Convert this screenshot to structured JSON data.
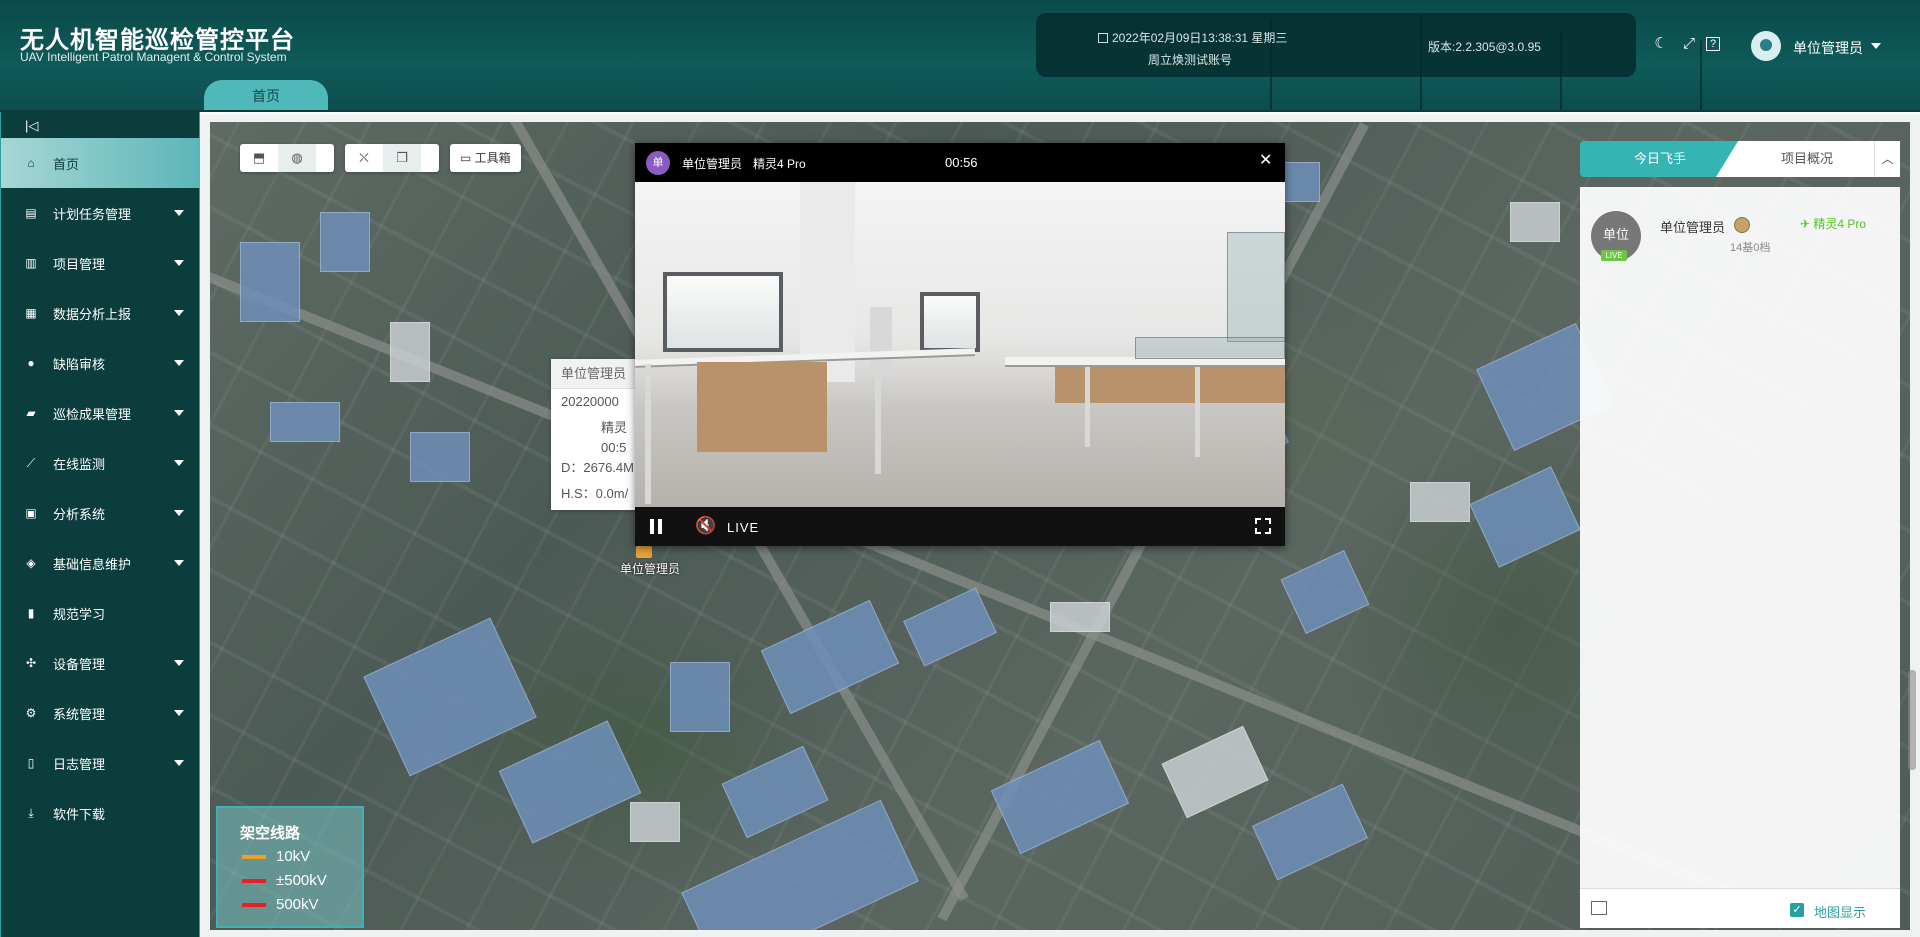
{
  "header": {
    "title_cn": "无人机智能巡检管控平台",
    "title_en": "UAV Intelligent Patrol Managent & Control System",
    "datetime": "2022年02月09日13:38:31 星期三",
    "account": "周立焕测试账号",
    "version": "版本:2.2.305@3.0.95",
    "user_name": "单位管理员",
    "home_tab": "首页"
  },
  "sidebar": {
    "collapse_icon": "collapse-left-icon",
    "items": [
      {
        "label": "首页",
        "icon": "home-icon",
        "active": true,
        "has_sub": false
      },
      {
        "label": "计划任务管理",
        "icon": "task-icon",
        "has_sub": true
      },
      {
        "label": "项目管理",
        "icon": "project-icon",
        "has_sub": true
      },
      {
        "label": "数据分析上报",
        "icon": "data-icon",
        "has_sub": true
      },
      {
        "label": "缺陷审核",
        "icon": "user-check-icon",
        "has_sub": true
      },
      {
        "label": "巡检成果管理",
        "icon": "folder-icon",
        "has_sub": true
      },
      {
        "label": "在线监测",
        "icon": "monitor-icon",
        "has_sub": true
      },
      {
        "label": "分析系统",
        "icon": "analysis-icon",
        "has_sub": true
      },
      {
        "label": "基础信息维护",
        "icon": "layers-icon",
        "has_sub": true
      },
      {
        "label": "规范学习",
        "icon": "book-icon",
        "has_sub": false
      },
      {
        "label": "设备管理",
        "icon": "drone-icon",
        "has_sub": true
      },
      {
        "label": "系统管理",
        "icon": "settings-user-icon",
        "has_sub": true
      },
      {
        "label": "日志管理",
        "icon": "log-icon",
        "has_sub": true
      },
      {
        "label": "软件下载",
        "icon": "download-icon",
        "has_sub": false
      }
    ]
  },
  "map": {
    "toolbox_label": "工具箱",
    "drone_card": {
      "title": "单位管理员",
      "serial": "20220000",
      "model": "精灵",
      "time": "00:5",
      "distance": "D：2676.4M",
      "hspeed": "H.S：0.0m/"
    },
    "drone_label": "单位管理员"
  },
  "video": {
    "avatar_text": "单",
    "user": "单位管理员",
    "model": "精灵4 Pro",
    "time": "00:56",
    "live_label": "LIVE"
  },
  "legend": {
    "title": "架空线路",
    "rows": [
      {
        "label": "10kV",
        "color": "#f0a020"
      },
      {
        "label": "±500kV",
        "color": "#e82020"
      },
      {
        "label": "500kV",
        "color": "#e82020"
      }
    ]
  },
  "right_panel": {
    "tab_active": "今日飞手",
    "tab_other": "项目概况",
    "pilot": {
      "avatar_text": "单位",
      "live_badge": "LIVE",
      "name": "单位管理员",
      "drone": "精灵4 Pro",
      "stat": "14基0档"
    },
    "map_display_label": "地图显示"
  },
  "colors": {
    "accent": "#36b3b3",
    "sidebar_bg": "#0b3d3d",
    "header_bg": "#0f5a5a",
    "drone_green": "#57c229"
  }
}
